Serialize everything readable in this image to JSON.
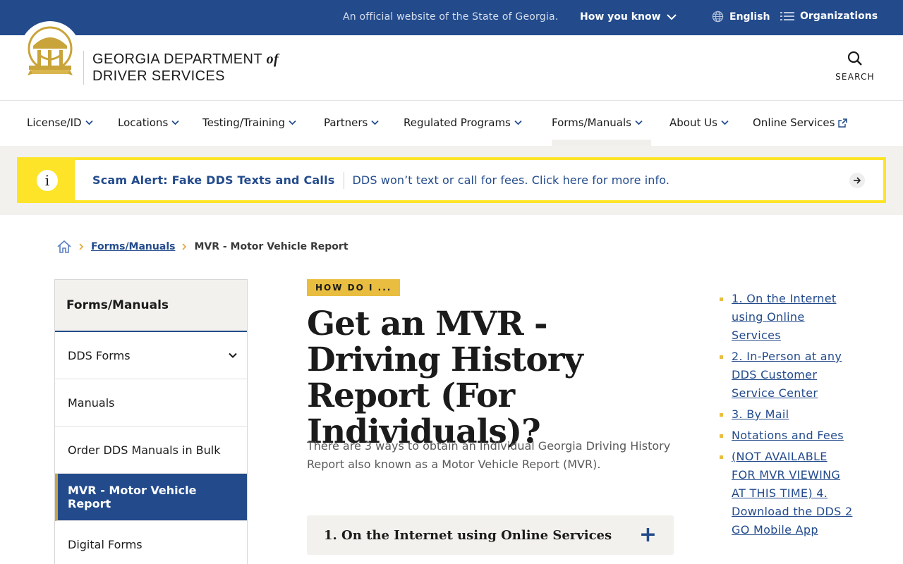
{
  "topbar": {
    "official_text": "An official website of the State of Georgia.",
    "how_you_know": "How you know",
    "language": "English",
    "organizations": "Organizations"
  },
  "header": {
    "title_line1": "GEORGIA DEPARTMENT",
    "title_of": "of",
    "title_line2": "DRIVER SERVICES",
    "search_label": "SEARCH"
  },
  "nav": {
    "items": [
      {
        "label": "License/ID",
        "icon": "chevron-down-icon"
      },
      {
        "label": "Locations",
        "icon": "chevron-down-icon"
      },
      {
        "label": "Testing/Training",
        "icon": "chevron-down-icon"
      },
      {
        "label": "Partners",
        "icon": "chevron-down-icon"
      },
      {
        "label": "Regulated Programs",
        "icon": "chevron-down-icon"
      },
      {
        "label": "Forms/Manuals",
        "icon": "chevron-down-icon"
      },
      {
        "label": "About Us",
        "icon": "chevron-down-icon"
      },
      {
        "label": "Online Services",
        "icon": "external-link-icon"
      }
    ],
    "active": "Forms/Manuals"
  },
  "alert": {
    "title": "Scam Alert: Fake DDS Texts and Calls",
    "text": "DDS won’t text or call for fees. Click here for more info."
  },
  "breadcrumb": {
    "parent": "Forms/Manuals",
    "current": "MVR - Motor Vehicle Report"
  },
  "sidebar": {
    "heading": "Forms/Manuals",
    "items": [
      {
        "label": "DDS Forms",
        "expandable": true
      },
      {
        "label": "Manuals"
      },
      {
        "label": "Order DDS Manuals in Bulk"
      },
      {
        "label": "MVR - Motor Vehicle Report",
        "active": true
      },
      {
        "label": "Digital Forms"
      }
    ]
  },
  "main": {
    "eyebrow": "HOW DO I ...",
    "title": "Get an MVR - Driving History Report (For Individuals)?",
    "intro": "There are 3 ways to obtain an Individual Georgia Driving History Report also known as a Motor Vehicle Report (MVR).",
    "accordion_title": "1. On the Internet using Online Services"
  },
  "toc": {
    "items": [
      "1. On the Internet using Online Services",
      "2. In-Person at any DDS Customer Service Center",
      "3. By Mail",
      "Notations and Fees",
      "(NOT AVAILABLE FOR MVR VIEWING AT THIS TIME) 4. Download the DDS 2 GO Mobile App"
    ]
  },
  "colors": {
    "brand_blue": "#234b8c",
    "gold": "#e9bd3f",
    "alert_yellow": "#fde428"
  }
}
